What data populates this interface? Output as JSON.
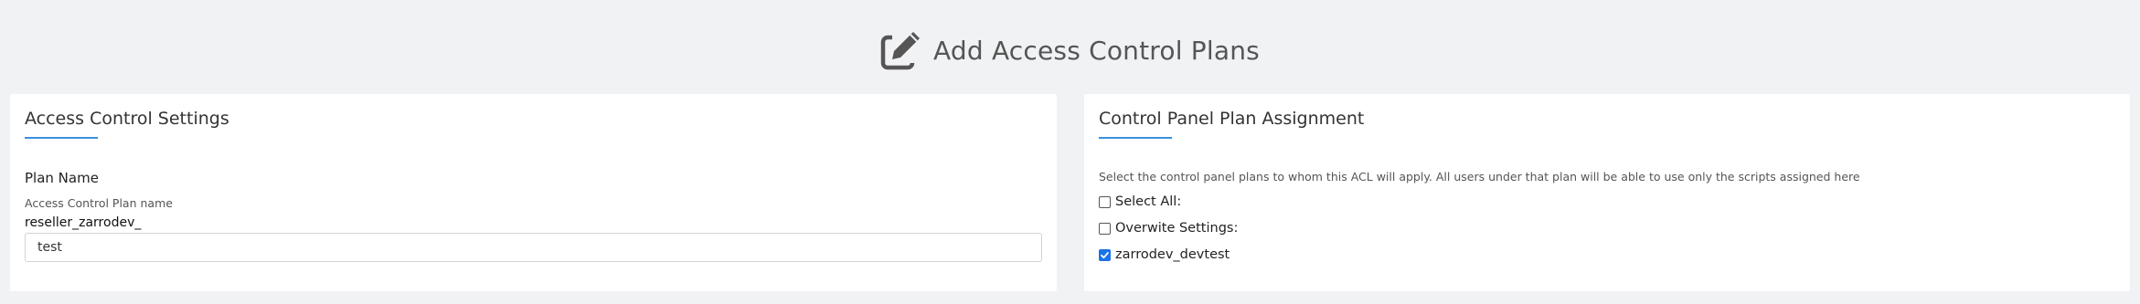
{
  "header": {
    "title": "Add Access Control Plans",
    "icon": "edit-icon"
  },
  "left_card": {
    "title": "Access Control Settings",
    "field_label": "Plan Name",
    "field_help": "Access Control Plan name",
    "prefix": "reseller_zarrodev_",
    "input_value": "test"
  },
  "right_card": {
    "title": "Control Panel Plan Assignment",
    "description": "Select the control panel plans to whom this ACL will apply. All users under that plan will be able to use only the scripts assigned here",
    "checkboxes": [
      {
        "label": "Select All:",
        "checked": false
      },
      {
        "label": "Overwite Settings:",
        "checked": false
      },
      {
        "label": "zarrodev_devtest",
        "checked": true
      }
    ]
  },
  "colors": {
    "accent": "#3a8fdc",
    "checkbox_checked": "#1a73e8",
    "background": "#f1f2f4"
  }
}
